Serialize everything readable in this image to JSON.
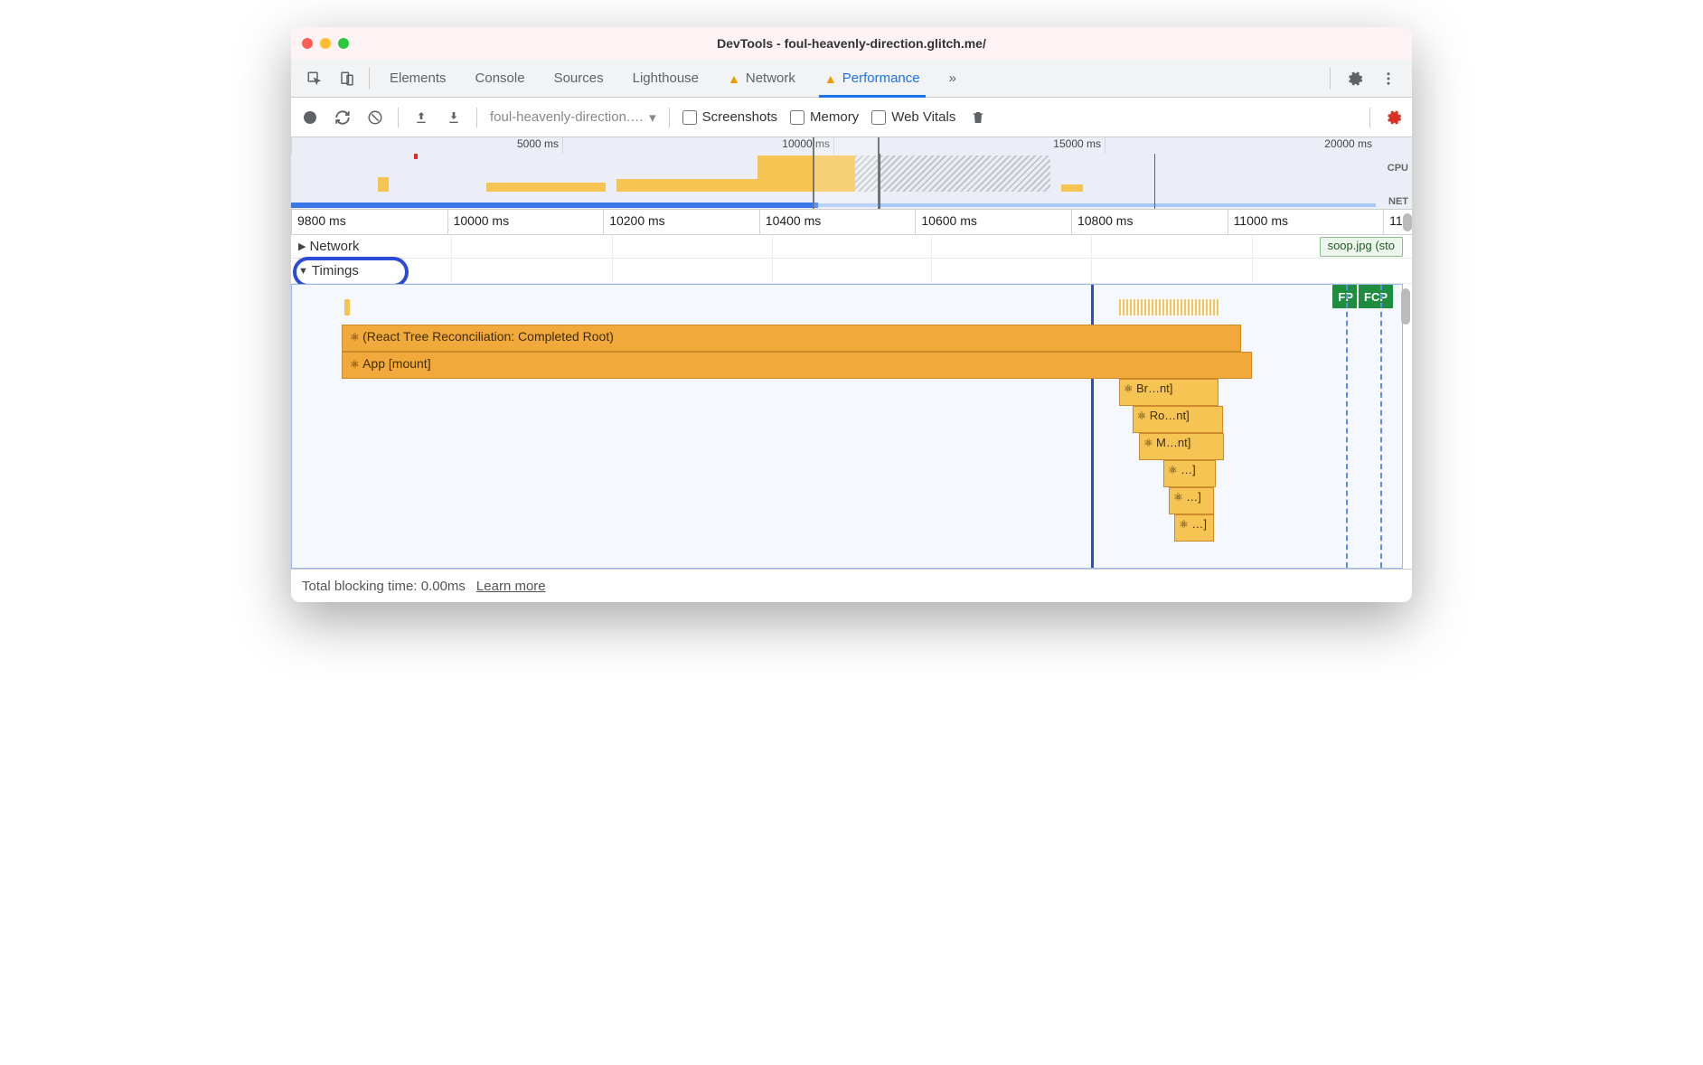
{
  "window": {
    "title": "DevTools - foul-heavenly-direction.glitch.me/"
  },
  "tabs": {
    "elements": "Elements",
    "console": "Console",
    "sources": "Sources",
    "lighthouse": "Lighthouse",
    "network": "Network",
    "performance": "Performance",
    "more": "»"
  },
  "controls": {
    "url_selector": "foul-heavenly-direction.…",
    "screenshots": "Screenshots",
    "memory": "Memory",
    "web_vitals": "Web Vitals"
  },
  "overview": {
    "ticks": [
      "5000 ms",
      "10000 ms",
      "15000 ms",
      "20000 ms"
    ],
    "labels": {
      "cpu": "CPU",
      "net": "NET"
    },
    "selection": {
      "left_pct": 46.5,
      "width_pct": 6.0
    }
  },
  "ruler": [
    "9800 ms",
    "10000 ms",
    "10200 ms",
    "10400 ms",
    "10600 ms",
    "10800 ms",
    "11000 ms",
    "11"
  ],
  "tracks": {
    "network_label": "Network",
    "timings_label": "Timings",
    "soop_label": "soop.jpg (sto",
    "fp": "FP",
    "fcp": "FCP",
    "flames": {
      "recon": "(React Tree Reconciliation: Completed Root)",
      "app": "App [mount]",
      "br": "Br…nt]",
      "ro": "Ro…nt]",
      "m": "M…nt]",
      "e1": "…]",
      "e2": "…]",
      "e3": "…]"
    }
  },
  "footer": {
    "tbt": "Total blocking time: 0.00ms",
    "learn": "Learn more"
  },
  "colors": {
    "accent": "#1a73e8",
    "flame_dark": "#f2a93b",
    "flame_light": "#f6c453",
    "fp_green": "#1e8e3e",
    "highlight": "#2a4ad8"
  }
}
